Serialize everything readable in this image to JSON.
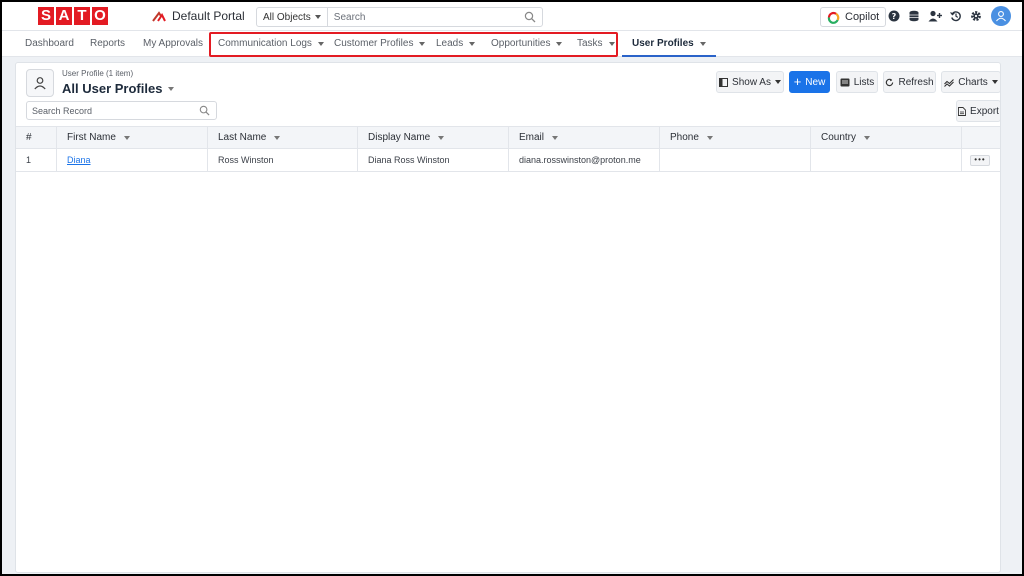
{
  "header": {
    "logo_letters": [
      "S",
      "A",
      "T",
      "O"
    ],
    "portal_name": "Default Portal",
    "object_filter": "All Objects",
    "search_placeholder": "Search",
    "copilot_label": "Copilot",
    "icons": [
      "help-icon",
      "database-icon",
      "add-user-icon",
      "history-icon",
      "settings-icon",
      "user-avatar-icon"
    ]
  },
  "tabs": [
    {
      "label": "Dashboard",
      "dropdown": false
    },
    {
      "label": "Reports",
      "dropdown": false
    },
    {
      "label": "My Approvals",
      "dropdown": false
    },
    {
      "label": "Communication Logs",
      "dropdown": true
    },
    {
      "label": "Customer Profiles",
      "dropdown": true
    },
    {
      "label": "Leads",
      "dropdown": true
    },
    {
      "label": "Opportunities",
      "dropdown": true
    },
    {
      "label": "Tasks",
      "dropdown": true
    },
    {
      "label": "User Profiles",
      "dropdown": true,
      "active": true
    }
  ],
  "view": {
    "subtitle": "User Profile (1 item)",
    "title": "All User Profiles",
    "search_placeholder": "Search Record"
  },
  "toolbar": {
    "show_as": "Show As",
    "new": "New",
    "lists": "Lists",
    "refresh": "Refresh",
    "charts": "Charts",
    "export": "Export"
  },
  "table": {
    "columns": [
      "#",
      "First Name",
      "Last Name",
      "Display Name",
      "Email",
      "Phone",
      "Country"
    ],
    "rows": [
      {
        "num": "1",
        "first_name": "Diana",
        "last_name": "Ross Winston",
        "display_name": "Diana Ross Winston",
        "email": "diana.rosswinston@proton.me",
        "phone": "",
        "country": ""
      }
    ],
    "row_action": "•••"
  },
  "colors": {
    "accent": "#1a73e8",
    "brand_red": "#e31b23",
    "active_tab_underline": "#2a63c9"
  }
}
